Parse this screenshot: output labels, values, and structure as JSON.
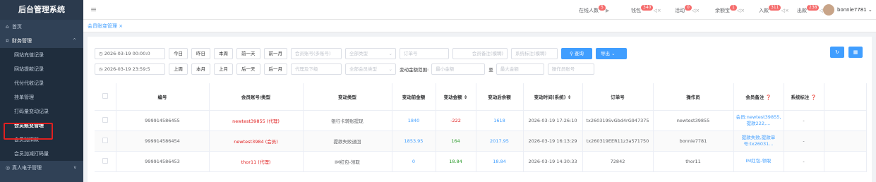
{
  "app_title": "后台管理系统",
  "sidebar": {
    "items": [
      {
        "label": "首页",
        "icon": "home-icon",
        "kind": "top"
      },
      {
        "label": "财务管理",
        "icon": "finance-icon",
        "kind": "group"
      },
      {
        "label": "网站充值记录",
        "kind": "sub"
      },
      {
        "label": "网站提款记录",
        "kind": "sub"
      },
      {
        "label": "代付代收记录",
        "kind": "sub"
      },
      {
        "label": "挂单管理",
        "kind": "sub"
      },
      {
        "label": "打码量变动记录",
        "kind": "sub"
      },
      {
        "label": "会员账变管理",
        "kind": "sub-active"
      },
      {
        "label": "会员加扣款",
        "kind": "sub"
      },
      {
        "label": "会员加减打码量",
        "kind": "sub"
      },
      {
        "label": "真人电子管理",
        "icon": "live-icon",
        "kind": "top"
      }
    ]
  },
  "topbar": {
    "online": {
      "label": "在线人数",
      "count": "5"
    },
    "wallet": {
      "label": "钱包",
      "count": "340"
    },
    "activity": {
      "label": "活动",
      "count": "0"
    },
    "yuebao": {
      "label": "余额宝",
      "count": "1"
    },
    "deposit": {
      "label": "入款",
      "count": "311"
    },
    "withdraw": {
      "label": "出款",
      "count": "238"
    },
    "username": "bonnie7781"
  },
  "tab": {
    "label": "会员账变管理 ×"
  },
  "filters": {
    "start_time": "2026-03-19 00:00:0",
    "end_time": "2026-03-19 23:59:5",
    "quick_row1": [
      "今日",
      "昨日",
      "本周",
      "前一天",
      "前一月"
    ],
    "quick_row2": [
      "上周",
      "本月",
      "上月",
      "后一天",
      "后一月"
    ],
    "member_account_ph": "会员账号(多账号)",
    "all_types": "全部类型",
    "order_no_ph": "订单号",
    "member_remark_ph": "会员备注(模糊)",
    "system_remark_ph": "系统标注(模糊)",
    "query_label": "查询",
    "export_label": "导出",
    "agent_ph": "代理及下级",
    "all_member_types": "全部会员类型",
    "amount_range_label": "变动金额范围:",
    "min_ph": "最小金额",
    "to_label": "至",
    "max_ph": "最大金额",
    "operator_ph": "操作员账号"
  },
  "table": {
    "headers": [
      "编号",
      "会员账号/类型",
      "变动类型",
      "变动前金额",
      "变动金额",
      "变动后余额",
      "变动时间(系统)",
      "订单号",
      "操作员",
      "会员备注",
      "系统标注"
    ],
    "rows": [
      {
        "id": "999914586455",
        "account": "newtest39855 (代理)",
        "type": "银行卡转账提现",
        "before": "1840",
        "amount": "-222",
        "after": "1618",
        "time": "2026-03-19 17:26:10",
        "order": "tx260319SvGbd4rG947375",
        "operator": "newtest39855",
        "member_remark": "会员:newtest39855,提款222,...",
        "sys_remark": "-"
      },
      {
        "id": "999914586454",
        "account": "newtest3984 (会员)",
        "type": "提款失败退回",
        "before": "1853.95",
        "amount": "164",
        "after": "2017.95",
        "time": "2026-03-19 16:13:29",
        "order": "tx260319EER11z3a571750",
        "operator": "bonnie7781",
        "member_remark": "提款失败,提款单号:tx26031...",
        "sys_remark": "-"
      },
      {
        "id": "999914586453",
        "account": "thor11 (代理)",
        "type": "IM红包-领取",
        "before": "0",
        "amount": "18.84",
        "after": "18.84",
        "time": "2026-03-19 14:30:33",
        "order": "72842",
        "operator": "thor11",
        "member_remark": "IM红包-领取",
        "sys_remark": "-"
      }
    ]
  },
  "colors": {
    "sidebar_bg": "#304156",
    "accent": "#409eff",
    "negative": "#e02020",
    "positive": "#2a9a2a",
    "highlight_box": "#e02020"
  }
}
